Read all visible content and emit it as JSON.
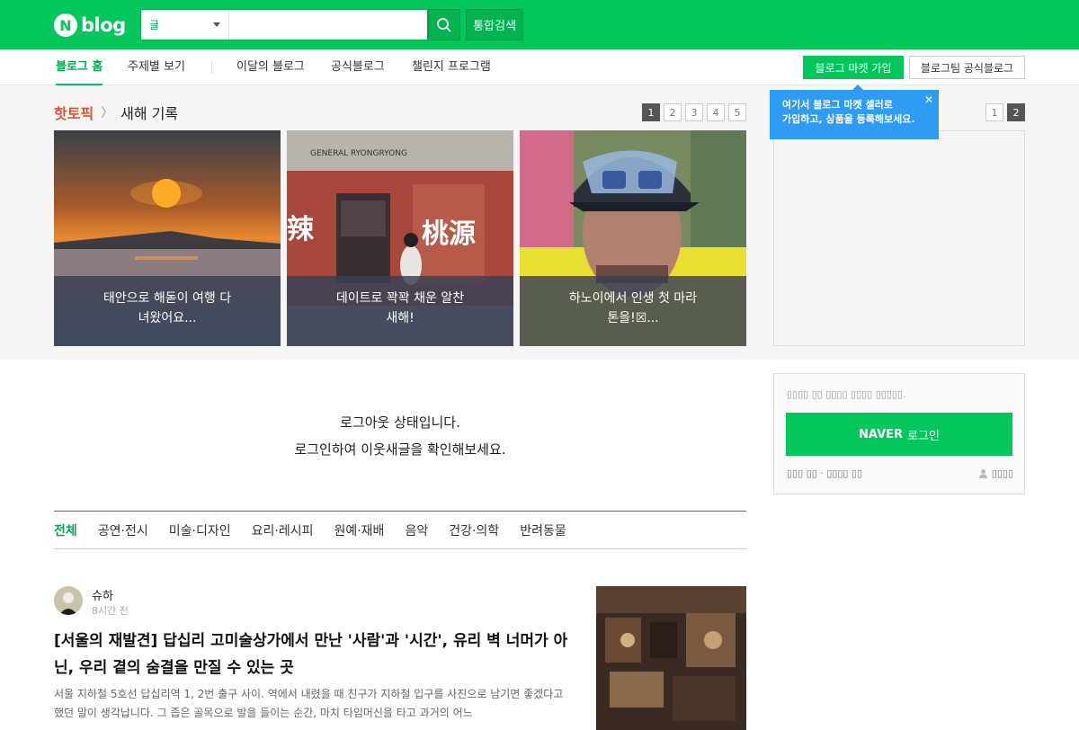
{
  "header": {
    "logo_n": "N",
    "logo_word": "blog",
    "search_type": "글",
    "search_value": "",
    "total_search": "통합검색"
  },
  "nav": {
    "items": [
      "블로그 홈",
      "주제별 보기",
      "이달의 블로그",
      "공식블로그",
      "챌린지 프로그램"
    ],
    "market_button": "블로그 마켓 가입",
    "official_button": "블로그팀 공식블로그"
  },
  "tooltip": {
    "line1": "여기서 블로그 마켓 셀러로",
    "line2": "가입하고, 상품을 등록해보세요."
  },
  "topic": {
    "label": "핫토픽",
    "name": "새해 기록",
    "pages": [
      "1",
      "2",
      "3",
      "4",
      "5"
    ],
    "active_page": 1,
    "side_pages": [
      "1",
      "2"
    ],
    "side_active_page": 2,
    "cards": [
      {
        "line1": "태안으로 해돋이 여행 다",
        "line2": "녀왔어요..."
      },
      {
        "line1": "데이트로 꽉꽉 채운 알찬",
        "line2": "새해!"
      },
      {
        "line1": "하노이에서 인생 첫 마라",
        "line2": "톤을!☒..."
      }
    ],
    "card2_sign": "GENERAL RYONGRYONG"
  },
  "logout": {
    "line1": "로그아웃 상태입니다.",
    "line2": "로그인하여 이웃새글을 확인해보세요."
  },
  "login_box": {
    "message": "▯▯▯▯ ▯▯ ▯▯▯▯ ▯▯▯▯ ▯▯▯▯▯.",
    "button_brand": "NAVER",
    "button_label": "로그인",
    "find_text": "▯▯▯ ▯▯ · ▯▯▯▯ ▯▯",
    "join_text": "▯▯▯▯"
  },
  "categories": [
    "전체",
    "공연·전시",
    "미술·디자인",
    "요리·레시피",
    "원예·재배",
    "음악",
    "건강·의학",
    "반려동물"
  ],
  "post": {
    "author": "슈하",
    "time": "8시간 전",
    "title": "[서울의 재발견] 답십리 고미술상가에서 만난 '사람'과 '시간', 유리 벽 너머가 아닌, 우리 곁의 숨결을 만질 수 있는 곳",
    "body": "서울 지하철 5호선 답십리역 1, 2번 출구 사이. 역에서 내렸을 때 친구가 지하철 입구를 사진으로 남기면 좋겠다고 했던 말이 생각납니다. 그 좁은 골목으로 발을 들이는 순간, 마치 타임머신을 타고 과거의 어느"
  },
  "colors": {
    "brand_green": "#03c75a",
    "tooltip_blue": "#2f9cf4",
    "hot_red": "#e2513a"
  }
}
